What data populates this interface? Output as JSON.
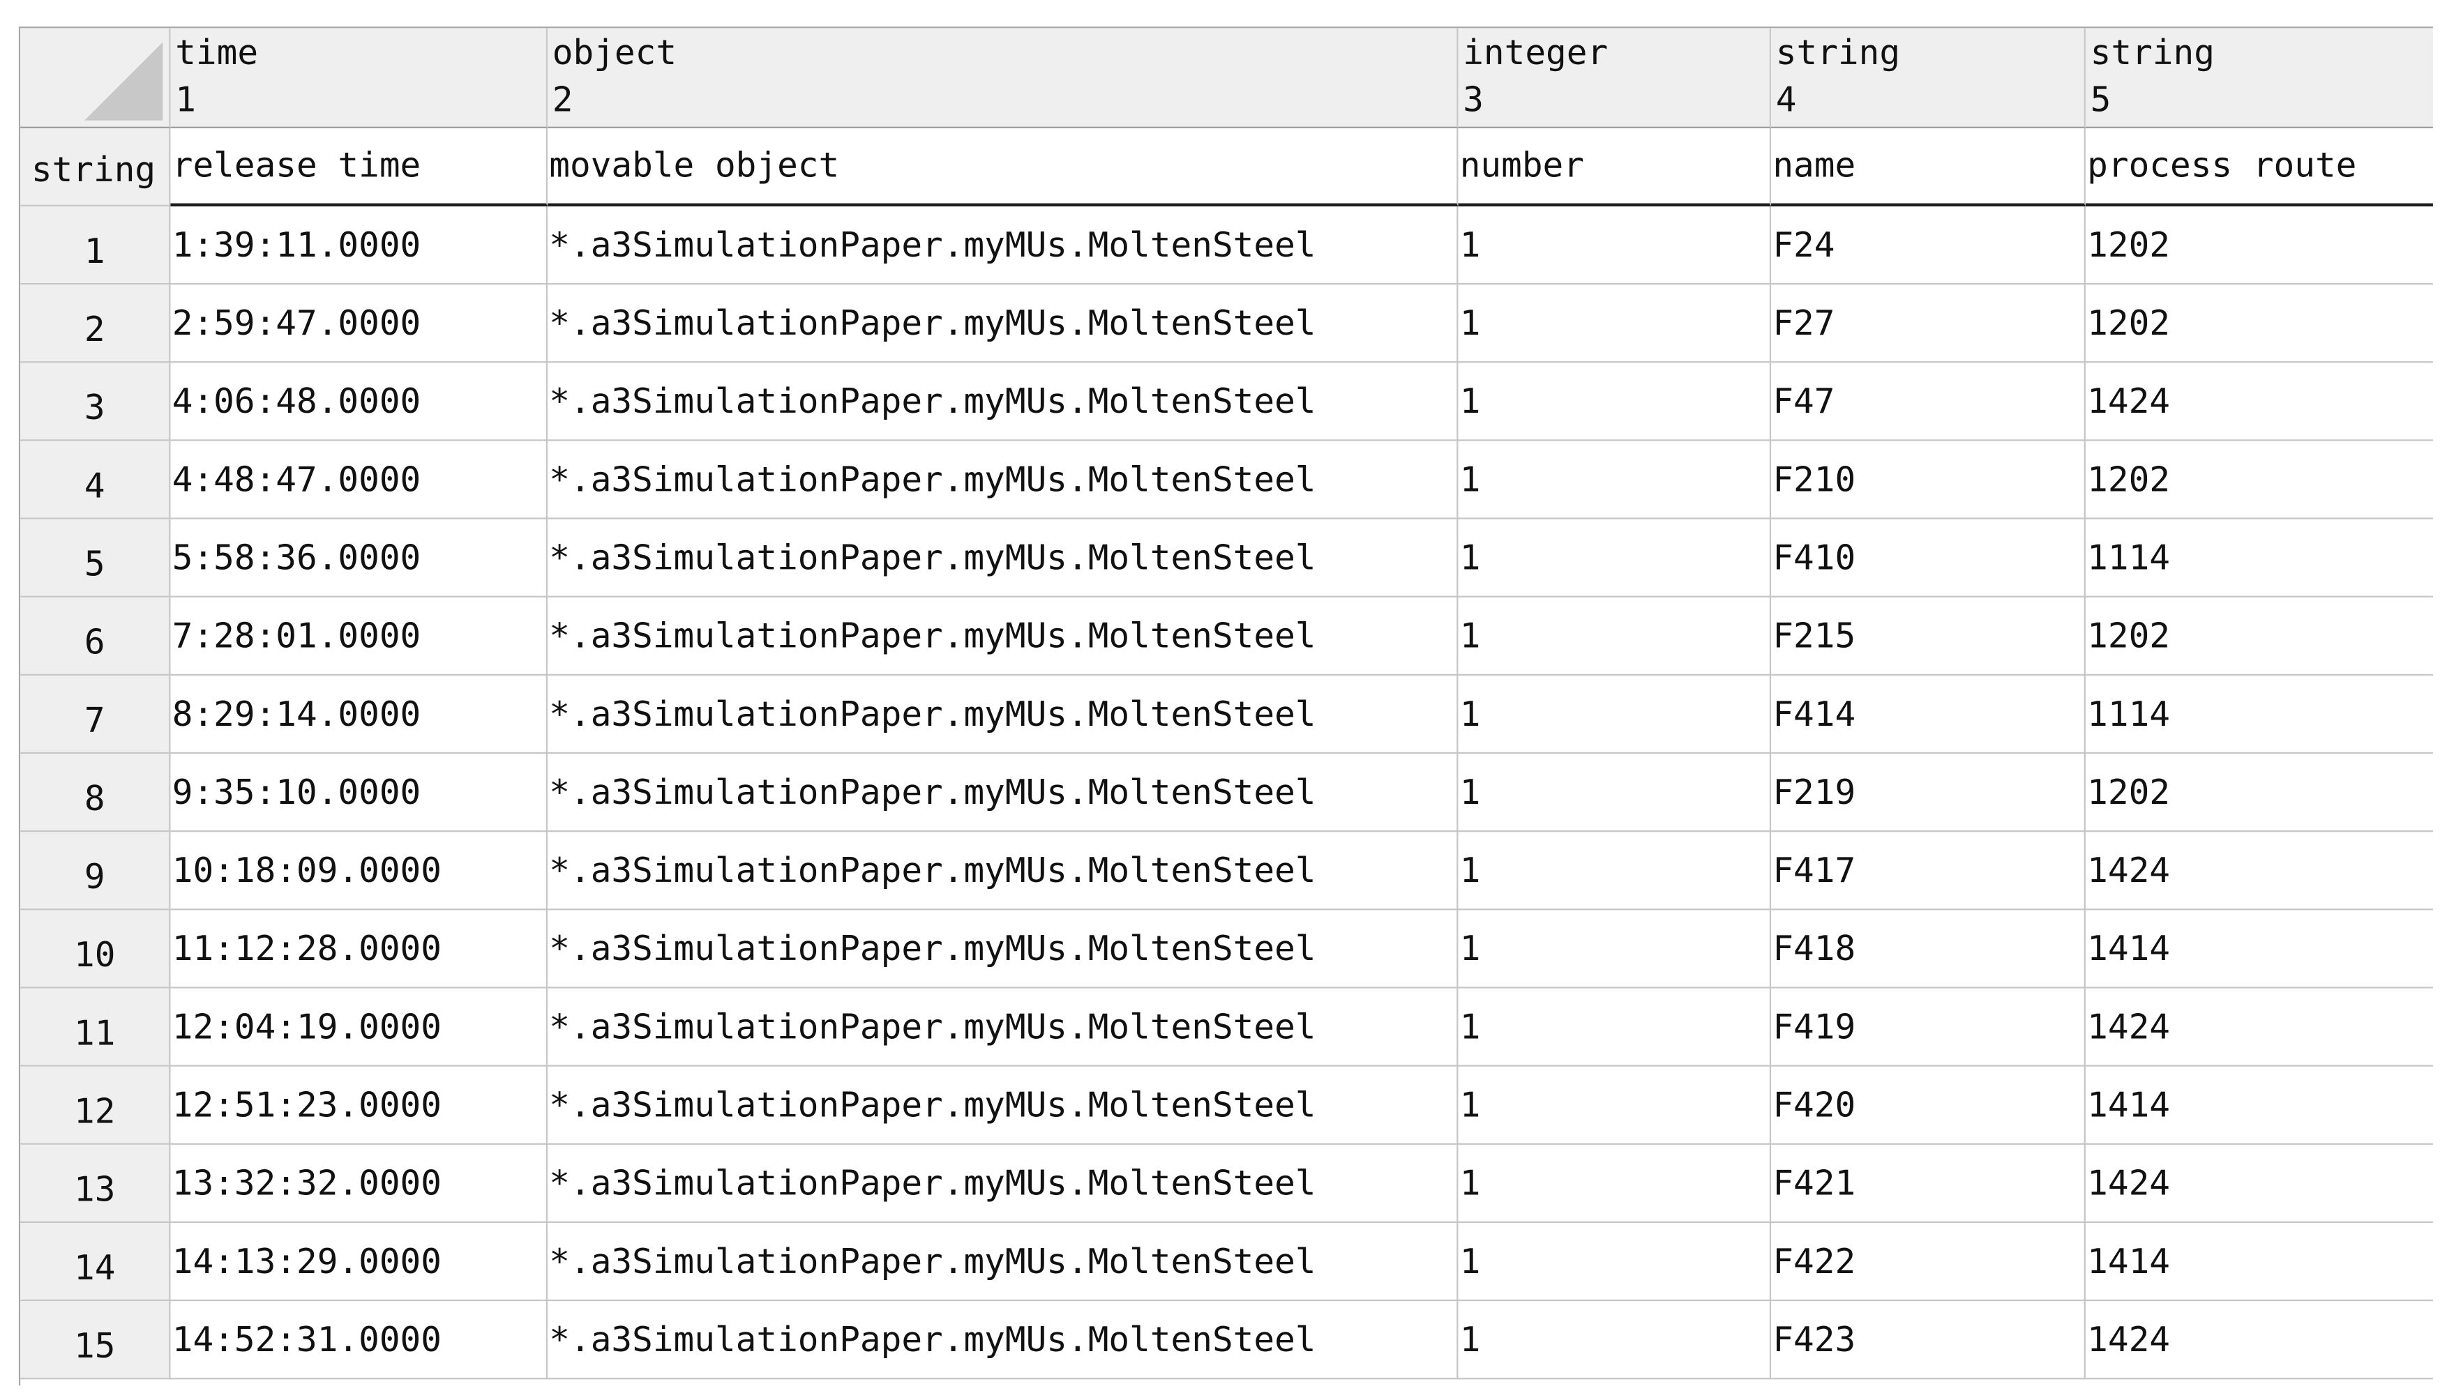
{
  "table": {
    "corner_label": "string",
    "columns": [
      {
        "type": "time",
        "index": "1",
        "name": "release time"
      },
      {
        "type": "object",
        "index": "2",
        "name": "movable object"
      },
      {
        "type": "integer",
        "index": "3",
        "name": "number"
      },
      {
        "type": "string",
        "index": "4",
        "name": "name"
      },
      {
        "type": "string",
        "index": "5",
        "name": "process route"
      }
    ],
    "rows": [
      {
        "index": "1",
        "release_time": "1:39:11.0000",
        "movable_object": "*.a3SimulationPaper.myMUs.MoltenSteel",
        "number": "1",
        "name": "F24",
        "process_route": "1202"
      },
      {
        "index": "2",
        "release_time": "2:59:47.0000",
        "movable_object": "*.a3SimulationPaper.myMUs.MoltenSteel",
        "number": "1",
        "name": "F27",
        "process_route": "1202"
      },
      {
        "index": "3",
        "release_time": "4:06:48.0000",
        "movable_object": "*.a3SimulationPaper.myMUs.MoltenSteel",
        "number": "1",
        "name": "F47",
        "process_route": "1424"
      },
      {
        "index": "4",
        "release_time": "4:48:47.0000",
        "movable_object": "*.a3SimulationPaper.myMUs.MoltenSteel",
        "number": "1",
        "name": "F210",
        "process_route": "1202"
      },
      {
        "index": "5",
        "release_time": "5:58:36.0000",
        "movable_object": "*.a3SimulationPaper.myMUs.MoltenSteel",
        "number": "1",
        "name": "F410",
        "process_route": "1114"
      },
      {
        "index": "6",
        "release_time": "7:28:01.0000",
        "movable_object": "*.a3SimulationPaper.myMUs.MoltenSteel",
        "number": "1",
        "name": "F215",
        "process_route": "1202"
      },
      {
        "index": "7",
        "release_time": "8:29:14.0000",
        "movable_object": "*.a3SimulationPaper.myMUs.MoltenSteel",
        "number": "1",
        "name": "F414",
        "process_route": "1114"
      },
      {
        "index": "8",
        "release_time": "9:35:10.0000",
        "movable_object": "*.a3SimulationPaper.myMUs.MoltenSteel",
        "number": "1",
        "name": "F219",
        "process_route": "1202"
      },
      {
        "index": "9",
        "release_time": "10:18:09.0000",
        "movable_object": "*.a3SimulationPaper.myMUs.MoltenSteel",
        "number": "1",
        "name": "F417",
        "process_route": "1424"
      },
      {
        "index": "10",
        "release_time": "11:12:28.0000",
        "movable_object": "*.a3SimulationPaper.myMUs.MoltenSteel",
        "number": "1",
        "name": "F418",
        "process_route": "1414"
      },
      {
        "index": "11",
        "release_time": "12:04:19.0000",
        "movable_object": "*.a3SimulationPaper.myMUs.MoltenSteel",
        "number": "1",
        "name": "F419",
        "process_route": "1424"
      },
      {
        "index": "12",
        "release_time": "12:51:23.0000",
        "movable_object": "*.a3SimulationPaper.myMUs.MoltenSteel",
        "number": "1",
        "name": "F420",
        "process_route": "1414"
      },
      {
        "index": "13",
        "release_time": "13:32:32.0000",
        "movable_object": "*.a3SimulationPaper.myMUs.MoltenSteel",
        "number": "1",
        "name": "F421",
        "process_route": "1424"
      },
      {
        "index": "14",
        "release_time": "14:13:29.0000",
        "movable_object": "*.a3SimulationPaper.myMUs.MoltenSteel",
        "number": "1",
        "name": "F422",
        "process_route": "1414"
      },
      {
        "index": "15",
        "release_time": "14:52:31.0000",
        "movable_object": "*.a3SimulationPaper.myMUs.MoltenSteel",
        "number": "1",
        "name": "F423",
        "process_route": "1424"
      }
    ]
  }
}
